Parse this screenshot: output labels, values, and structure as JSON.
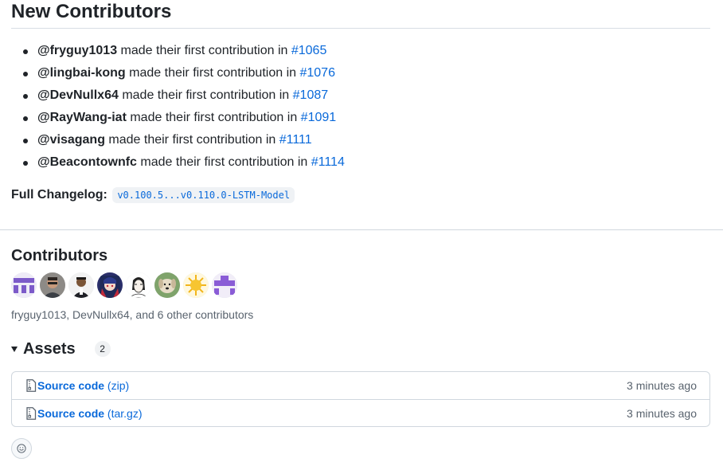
{
  "new_contributors": {
    "title": "New Contributors",
    "items": [
      {
        "user": "@fryguy1013",
        "text": " made their first contribution in ",
        "pr": "#1065"
      },
      {
        "user": "@lingbai-kong",
        "text": " made their first contribution in ",
        "pr": "#1076"
      },
      {
        "user": "@DevNullx64",
        "text": " made their first contribution in ",
        "pr": "#1087"
      },
      {
        "user": "@RayWang-iat",
        "text": " made their first contribution in ",
        "pr": "#1091"
      },
      {
        "user": "@visagang",
        "text": " made their first contribution in ",
        "pr": "#1111"
      },
      {
        "user": "@Beacontownfc",
        "text": " made their first contribution in ",
        "pr": "#1114"
      }
    ]
  },
  "changelog": {
    "label": "Full Changelog",
    "separator": ":",
    "value": "v0.100.5...v0.110.0-LSTM-Model"
  },
  "contributors": {
    "title": "Contributors",
    "avatars": [
      {
        "name": "identicon-purple-avatar",
        "color": "#7c5ac9"
      },
      {
        "name": "photo-avatar-1"
      },
      {
        "name": "photo-avatar-2"
      },
      {
        "name": "anime-avatar"
      },
      {
        "name": "sketch-avatar"
      },
      {
        "name": "dog-avatar"
      },
      {
        "name": "sun-avatar"
      },
      {
        "name": "identicon-violet-avatar",
        "color": "#8a5cd6"
      }
    ],
    "summary": "fryguy1013, DevNullx64, and 6 other contributors"
  },
  "assets": {
    "title": "Assets",
    "count": "2",
    "files": [
      {
        "name": "Source code",
        "ext": "(zip)",
        "time": "3 minutes ago",
        "icon": "file-zip-icon"
      },
      {
        "name": "Source code",
        "ext": "(tar.gz)",
        "time": "3 minutes ago",
        "icon": "file-zip-icon"
      }
    ]
  },
  "reaction": {
    "icon": "smiley-icon"
  }
}
